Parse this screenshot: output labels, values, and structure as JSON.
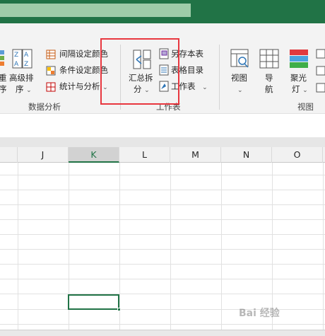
{
  "ribbon": {
    "sort_group": {
      "left_clip_label1": "重",
      "left_clip_label2": "序",
      "advanced_sort_line1": "高级排",
      "advanced_sort_line2": "序",
      "interval_color": "间隔设定颜色",
      "condition_color": "条件设定颜色",
      "stats_analysis": "统计与分析",
      "group_label": "数据分析"
    },
    "worksheet_group": {
      "summary_split_line1": "汇总拆",
      "summary_split_line2": "分",
      "save_workbook": "另存本表",
      "sheet_index": "表格目录",
      "worksheet": "工作表",
      "group_label": "工作表"
    },
    "view_group": {
      "view": "视图",
      "nav_line1": "导",
      "nav_line2": "航",
      "spotlight_line1": "聚光",
      "spotlight_line2": "灯",
      "group_label": "视图"
    }
  },
  "sheet": {
    "columns": [
      "J",
      "K",
      "L",
      "M",
      "N",
      "O"
    ],
    "active_column": "K"
  },
  "watermark": "Bai 经验"
}
